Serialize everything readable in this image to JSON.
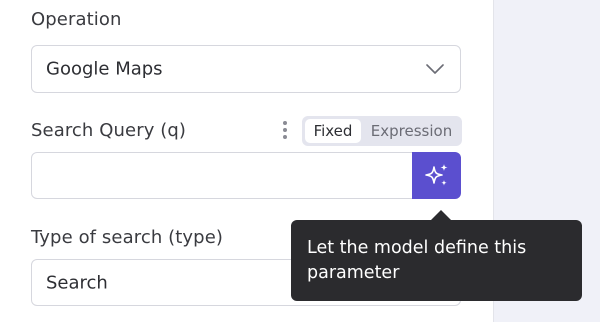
{
  "operation": {
    "label": "Operation",
    "value": "Google Maps"
  },
  "search_query": {
    "label": "Search Query (q)",
    "value": "",
    "mode_fixed": "Fixed",
    "mode_expression": "Expression"
  },
  "type_of_search": {
    "label": "Type of search (type)",
    "value": "Search"
  },
  "ai_button": {
    "icon": "sparkles-icon"
  },
  "tooltip": {
    "text": "Let the model define this parameter"
  },
  "colors": {
    "accent": "#5b4fcf",
    "tooltip_bg": "#2b2b2e",
    "border": "#d6d7de",
    "panel_bg": "#f0f1f8"
  }
}
